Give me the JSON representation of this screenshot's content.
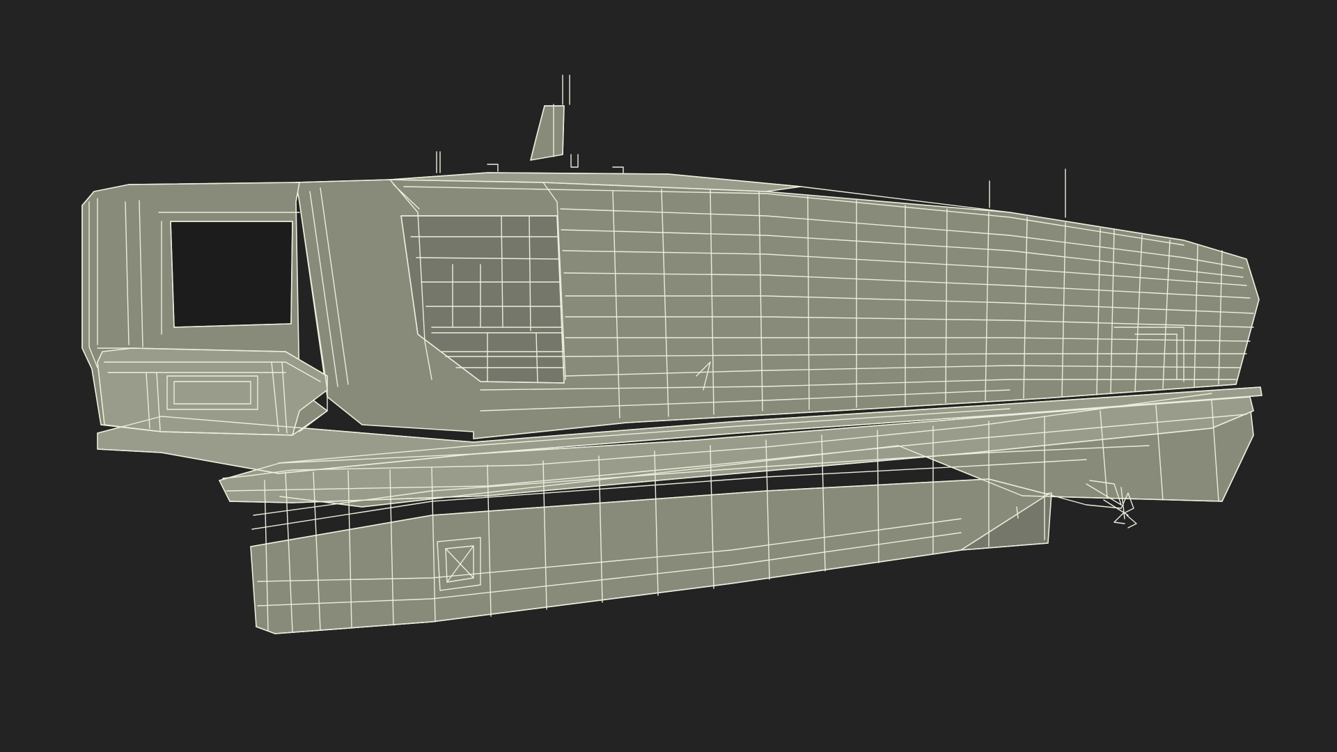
{
  "scene": {
    "subject": "boat-hull-wireframe",
    "colors": {
      "background": "#232323",
      "surface": "#898b7a",
      "surface_dark": "#75776a",
      "surface_light": "#9a9c8b",
      "opening": "#1c1c1c",
      "wire": "#eceedd"
    }
  }
}
